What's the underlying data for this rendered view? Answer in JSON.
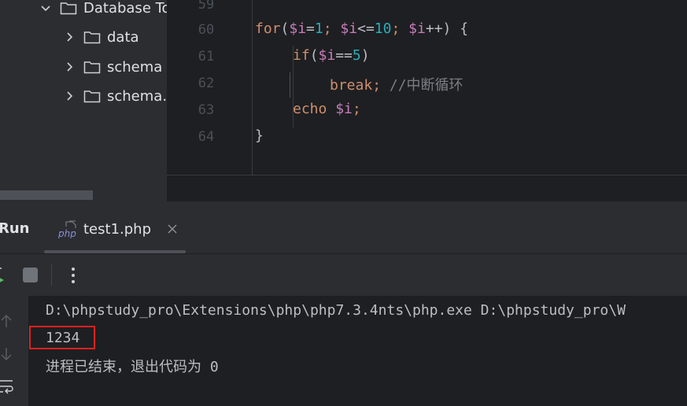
{
  "project_tree": {
    "items": [
      {
        "label": "Database To",
        "icon": "folder-icon",
        "chevron": "chevron-down-icon"
      },
      {
        "label": "data",
        "icon": "folder-icon",
        "chevron": "chevron-right-icon"
      },
      {
        "label": "schema",
        "icon": "folder-icon",
        "chevron": "chevron-right-icon"
      },
      {
        "label": "schema.l",
        "icon": "folder-icon",
        "chevron": "chevron-right-icon"
      }
    ]
  },
  "editor": {
    "line_numbers": [
      "59",
      "60",
      "61",
      "62",
      "63",
      "64"
    ],
    "lines": {
      "l60": {
        "t1": "for",
        "t2": "(",
        "t3": "$i",
        "t4": "=",
        "t5": "1",
        "t6": "; ",
        "t7": "$i",
        "t8": "<=",
        "t9": "10",
        "t10": "; ",
        "t11": "$i",
        "t12": "++) {"
      },
      "l61": {
        "t1": "if",
        "t2": "(",
        "t3": "$i",
        "t4": "==",
        "t5": "5",
        "t6": ")"
      },
      "l62": {
        "t1": "break",
        "t2": "; ",
        "t3": "//中断循环"
      },
      "l63": {
        "t1": "echo",
        "t2": " ",
        "t3": "$i",
        "t4": ";"
      },
      "l64": {
        "t1": "}"
      }
    }
  },
  "run_panel": {
    "title": "Run",
    "tab_label": "test1.php",
    "tab_icon": "php-file-icon",
    "close_icon": "close-icon"
  },
  "console": {
    "command": "D:\\phpstudy_pro\\Extensions\\php\\php7.3.4nts\\php.exe D:\\phpstudy_pro\\W",
    "output": "1234",
    "exit_message": "进程已结束，退出代码为 0"
  },
  "colors": {
    "highlight_border": "#e0201f",
    "keyword": "#cf8e6d",
    "variable": "#c77dbb",
    "number": "#2aacb8",
    "comment": "#7a7e85"
  }
}
